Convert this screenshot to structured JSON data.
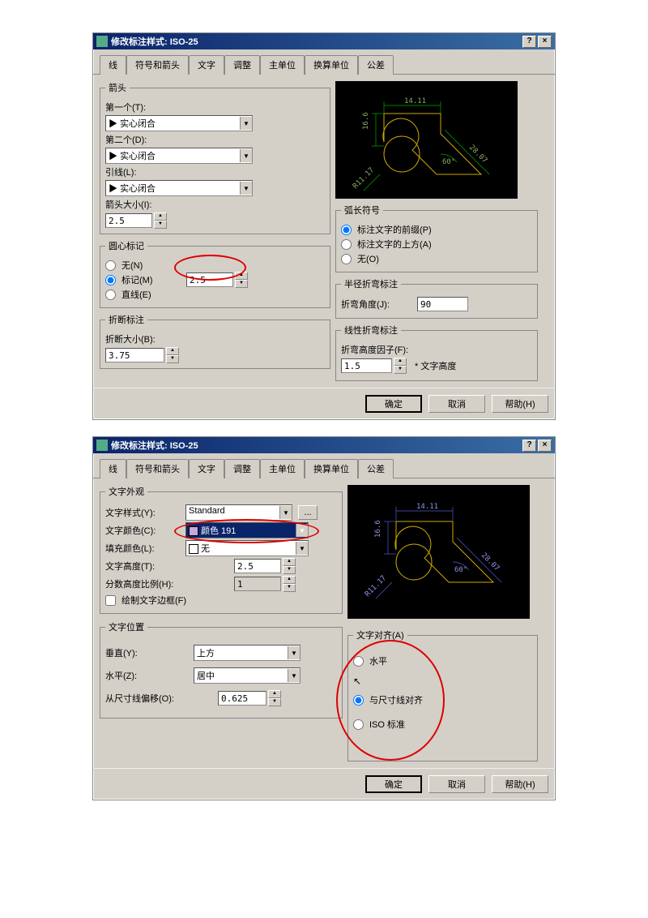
{
  "dialog_title": "修改标注样式: ISO-25",
  "tabs": [
    "线",
    "符号和箭头",
    "文字",
    "调整",
    "主单位",
    "换算单位",
    "公差"
  ],
  "buttons": {
    "ok": "确定",
    "cancel": "取消",
    "help": "帮助(H)"
  },
  "d1": {
    "active_tab": 1,
    "arrows": {
      "legend": "箭头",
      "first_label": "第一个(T):",
      "first_value": "实心闭合",
      "second_label": "第二个(D):",
      "second_value": "实心闭合",
      "leader_label": "引线(L):",
      "leader_value": "实心闭合",
      "size_label": "箭头大小(I):",
      "size_value": "2.5"
    },
    "center": {
      "legend": "圆心标记",
      "none": "无(N)",
      "mark": "标记(M)",
      "line": "直线(E)",
      "value": "2.5"
    },
    "break": {
      "legend": "折断标注",
      "size_label": "折断大小(B):",
      "value": "3.75"
    },
    "arc": {
      "legend": "弧长符号",
      "before": "标注文字的前缀(P)",
      "above": "标注文字的上方(A)",
      "none": "无(O)"
    },
    "radjog": {
      "legend": "半径折弯标注",
      "angle_label": "折弯角度(J):",
      "angle_value": "90"
    },
    "linjog": {
      "legend": "线性折弯标注",
      "factor_label": "折弯高度因子(F):",
      "factor_value": "1.5",
      "suffix": "* 文字高度"
    },
    "preview": {
      "dim1": "14.11",
      "dim2": "16.6",
      "dim3": "28.07",
      "dim4": "R11.17",
      "dim5": "60°"
    }
  },
  "d2": {
    "active_tab": 2,
    "appear": {
      "legend": "文字外观",
      "style_label": "文字样式(Y):",
      "style_value": "Standard",
      "color_label": "文字颜色(C):",
      "color_value": "颜色 191",
      "fill_label": "填充颜色(L):",
      "fill_value": "无",
      "height_label": "文字高度(T):",
      "height_value": "2.5",
      "fraction_label": "分数高度比例(H):",
      "fraction_value": "1",
      "frame_label": "绘制文字边框(F)"
    },
    "placement": {
      "legend": "文字位置",
      "vert_label": "垂直(Y):",
      "vert_value": "上方",
      "horiz_label": "水平(Z):",
      "horiz_value": "居中",
      "offset_label": "从尺寸线偏移(O):",
      "offset_value": "0.625"
    },
    "align": {
      "legend": "文字对齐(A)",
      "horiz": "水平",
      "dimline": "与尺寸线对齐",
      "iso": "ISO 标准"
    },
    "preview": {
      "dim1": "14.11",
      "dim2": "16.6",
      "dim3": "28.07",
      "dim4": "R11.17",
      "dim5": "60°"
    }
  }
}
